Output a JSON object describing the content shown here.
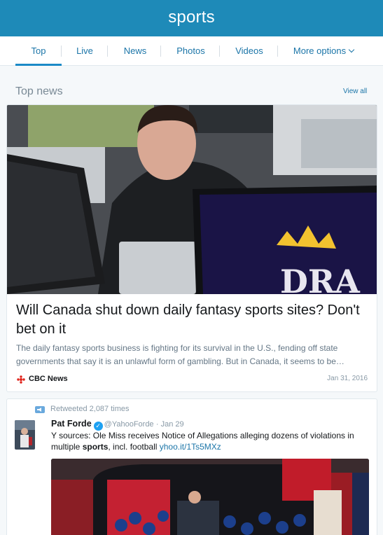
{
  "header": {
    "title": "sports"
  },
  "tabs": [
    {
      "label": "Top"
    },
    {
      "label": "Live"
    },
    {
      "label": "News"
    },
    {
      "label": "Photos"
    },
    {
      "label": "Videos"
    },
    {
      "label": "More options"
    }
  ],
  "section": {
    "title": "Top news",
    "view_all": "View all"
  },
  "news_card": {
    "headline": "Will Canada shut down daily fantasy sports sites? Don't bet on it",
    "summary": "The daily fantasy sports business is fighting for its survival in the U.S., fending off state governments that say it is an unlawful form of gambling. But in Canada, it seems to be…",
    "source": "CBC News",
    "date": "Jan 31, 2016",
    "image_logo_text": "DRA"
  },
  "tweet_card": {
    "retweet_text": "Retweeted 2,087 times",
    "author_name": "Pat Forde",
    "author_handle": "@YahooForde",
    "time": "· Jan 29",
    "text_before": "Y sources: Ole Miss receives Notice of Allegations alleging dozens of violations in multiple ",
    "text_bold": "sports",
    "text_after": ", incl. football ",
    "link": "yhoo.it/1Ts5MXz"
  },
  "colors": {
    "brand": "#1e8ab8",
    "link": "#1b75a8",
    "background": "#f5f8fa",
    "verified": "#1da1f2",
    "cbc_red": "#e0231a"
  }
}
